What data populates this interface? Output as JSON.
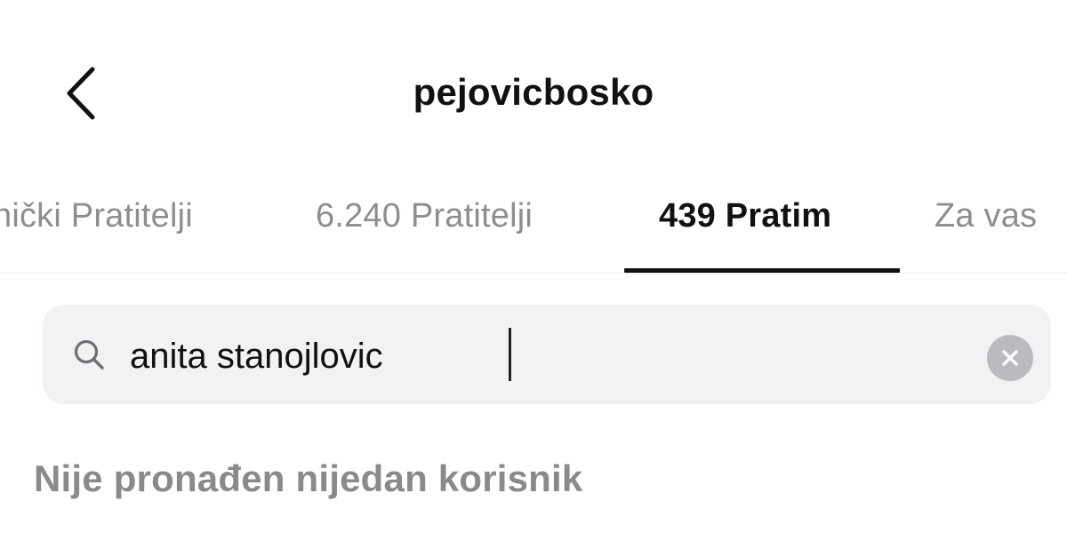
{
  "header": {
    "title": "pejovicbosko",
    "back_icon": "chevron-left-icon"
  },
  "tabs": [
    {
      "label": "nički Pratitelji",
      "active": false
    },
    {
      "label": "6.240 Pratitelji",
      "active": false
    },
    {
      "label": "439 Pratim",
      "active": true
    },
    {
      "label": "Za vas",
      "active": false
    }
  ],
  "search": {
    "value": "anita stanojlovic",
    "icon": "search-icon",
    "clear_icon": "clear-icon"
  },
  "results": {
    "empty_message": "Nije pronađen nijedan korisnik"
  },
  "colors": {
    "active_tab": "#111111",
    "inactive_tab": "#8e8e8e",
    "search_background": "#f1f2f3",
    "empty_message": "#8a8a8a"
  }
}
